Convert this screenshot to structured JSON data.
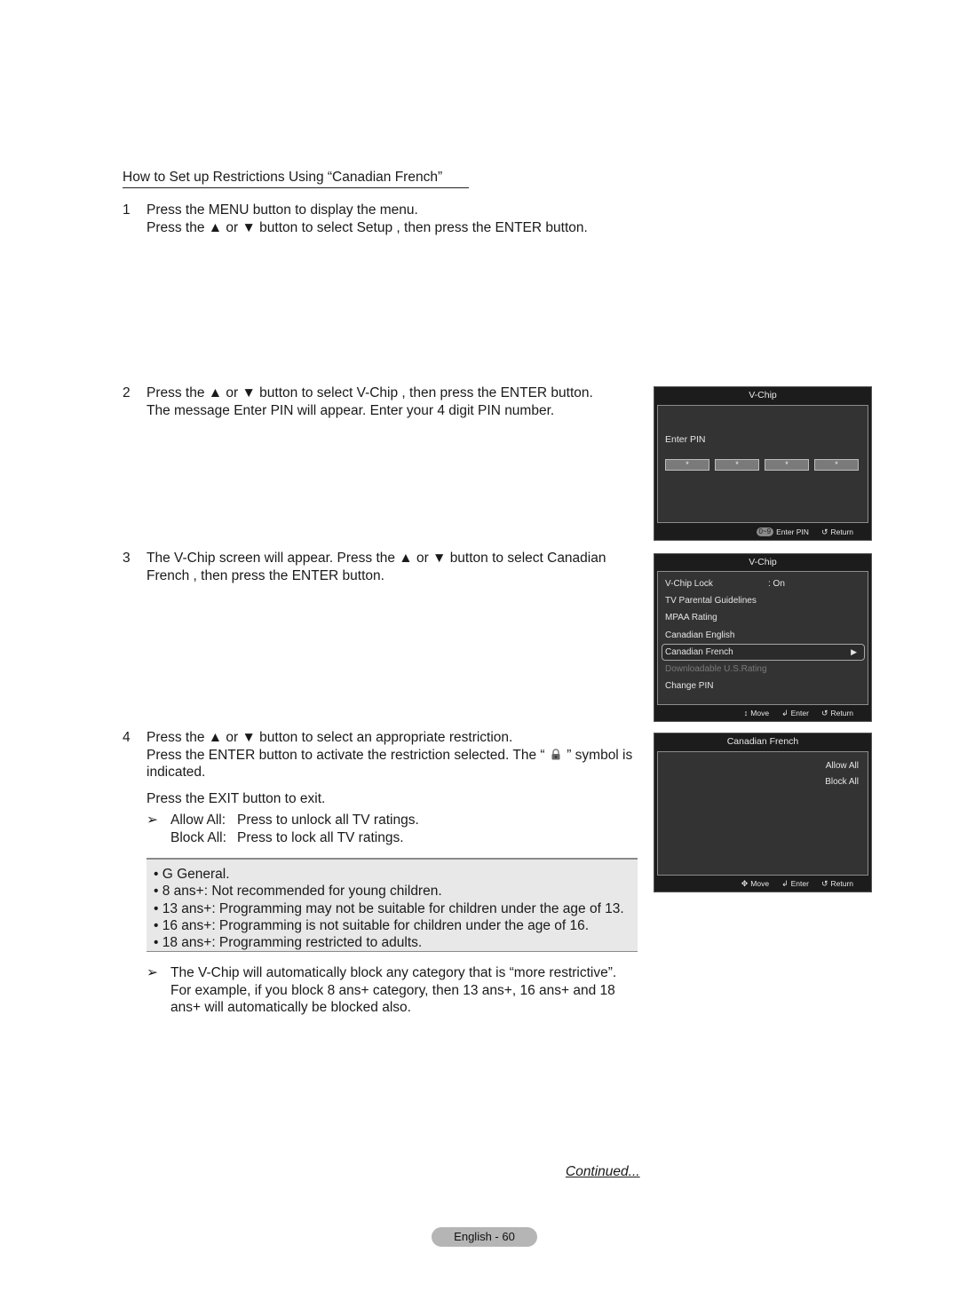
{
  "section_title": "How to Set up Restrictions Using “Canadian French”",
  "steps": [
    {
      "number": "1",
      "lines": [
        "Press the MENU button to display the menu.",
        "Press the ▲ or ▼ button to select Setup , then press the ENTER button."
      ]
    },
    {
      "number": "2",
      "lines": [
        "Press the ▲ or ▼ button to select V-Chip , then press the ENTER button.",
        "The message Enter PIN will appear. Enter your 4 digit PIN number."
      ]
    },
    {
      "number": "3",
      "lines": [
        "The V-Chip screen will appear. Press the ▲ or ▼ button to select Canadian",
        "French , then press the ENTER button."
      ]
    },
    {
      "number": "4",
      "lines": [
        "Press the ▲ or ▼ button to select an appropriate restriction.",
        "Press the ENTER button to activate the restriction selected. The “",
        "” symbol is",
        "indicated."
      ],
      "exit_line": "Press the EXIT button to exit.",
      "notes": [
        {
          "arrow": "➢",
          "label": "Allow All:",
          "text": "Press to unlock all TV ratings."
        },
        {
          "arrow": "",
          "label": "Block All:",
          "text": "Press to lock all TV ratings."
        }
      ]
    }
  ],
  "ratings": [
    "• G  General.",
    "• 8 ans+:  Not recommended for young children.",
    "• 13 ans+:  Programming may not be suitable for children under the age of 13.",
    "• 16 ans+:  Programming is not suitable for children under the age of 16.",
    "• 18 ans+:  Programming restricted to adults."
  ],
  "bottom_note": {
    "arrow": "➢",
    "lines": [
      "The V-Chip will automatically block any category that is “more restrictive”.",
      "For example, if you block 8 ans+ category, then 13 ans+, 16 ans+ and 18",
      "ans+ will automatically be blocked also."
    ]
  },
  "continued": "Continued...",
  "page_label": "English - 60",
  "screens": {
    "pin": {
      "title": "V-Chip",
      "label": "Enter PIN",
      "pin_chars": [
        "*",
        "*",
        "*",
        "*"
      ],
      "footer": {
        "keypad": "0~9",
        "enter_pin": "Enter PIN",
        "return": "Return"
      }
    },
    "vchip": {
      "title": "V-Chip",
      "items": [
        {
          "label": "V-Chip Lock",
          "value": ": On"
        },
        {
          "label": "TV Parental Guidelines"
        },
        {
          "label": "MPAA Rating"
        },
        {
          "label": "Canadian English"
        },
        {
          "label": "Canadian French",
          "selected": true
        },
        {
          "label": "Downloadable U.S.Rating",
          "disabled": true
        },
        {
          "label": "Change PIN"
        }
      ],
      "footer": {
        "move": "Move",
        "enter": "Enter",
        "return": "Return"
      }
    },
    "canadian_french": {
      "title": "Canadian French",
      "options": [
        "Allow All",
        "Block All"
      ],
      "footer": {
        "move": "Move",
        "enter": "Enter",
        "return": "Return"
      }
    }
  },
  "colors": {
    "tv_background": "#1c1c1c",
    "tv_panel": "#333333",
    "rating_box": "#e8e8e8",
    "page_pill": "#b5b5b5"
  }
}
